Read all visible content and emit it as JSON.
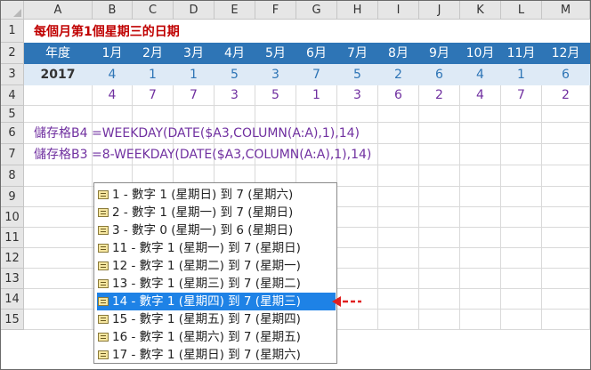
{
  "columns": [
    "A",
    "B",
    "C",
    "D",
    "E",
    "F",
    "G",
    "H",
    "I",
    "J",
    "K",
    "L",
    "M"
  ],
  "rows": [
    "1",
    "2",
    "3",
    "4",
    "5",
    "6",
    "7",
    "8",
    "9",
    "10",
    "11",
    "12",
    "13",
    "14",
    "15"
  ],
  "title": "每個月第1個星期三的日期",
  "header": {
    "label": "年度",
    "months": [
      "1月",
      "2月",
      "3月",
      "4月",
      "5月",
      "6月",
      "7月",
      "8月",
      "9月",
      "10月",
      "11月",
      "12月"
    ]
  },
  "row3": {
    "year": "2017",
    "values": [
      "4",
      "1",
      "1",
      "5",
      "3",
      "7",
      "5",
      "2",
      "6",
      "4",
      "1",
      "6"
    ]
  },
  "row4": {
    "values": [
      "4",
      "7",
      "7",
      "3",
      "5",
      "1",
      "3",
      "6",
      "2",
      "4",
      "7",
      "2"
    ]
  },
  "formulas": [
    {
      "cell": "儲存格B4",
      "formula": "=WEEKDAY(DATE($A3,COLUMN(A:A),1),14)"
    },
    {
      "cell": "儲存格B3",
      "formula": "=8-WEEKDAY(DATE($A3,COLUMN(A:A),1),14)"
    }
  ],
  "autocomplete": {
    "icon": "argument-option-icon",
    "selected_index": 6,
    "items": [
      "1 - 數字 1 (星期日) 到 7 (星期六)",
      "2 - 數字 1 (星期一) 到 7 (星期日)",
      "3 - 數字 0 (星期一) 到 6 (星期日)",
      "11 - 數字 1 (星期一) 到 7 (星期日)",
      "12 - 數字 1 (星期二) 到 7 (星期一)",
      "13 - 數字 1 (星期三) 到 7 (星期二)",
      "14 - 數字 1 (星期四) 到 7 (星期三)",
      "15 - 數字 1 (星期五) 到 7 (星期四)",
      "16 - 數字 1 (星期六) 到 7 (星期五)",
      "17 - 數字 1 (星期日) 到 7 (星期六)"
    ]
  },
  "colors": {
    "header_bg": "#2e75b6",
    "row3_bg": "#deeaf6",
    "row3_text": "#2e75b6",
    "row4_text": "#7030a0",
    "title_text": "#c00000",
    "selection_bg": "#1e82e6",
    "arrow": "#e02020"
  }
}
